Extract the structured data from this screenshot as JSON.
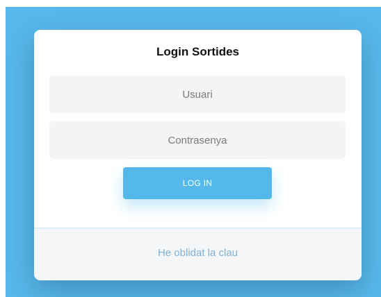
{
  "login": {
    "title": "Login Sortides",
    "username_placeholder": "Usuari",
    "password_placeholder": "Contrasenya",
    "submit_label": "LOG IN",
    "forgot_label": "He oblidat la clau"
  },
  "colors": {
    "background": "#58b8ea",
    "card": "#ffffff",
    "accent": "#55b8ea",
    "field": "#f4f4f4",
    "link": "#7fb2d8"
  }
}
